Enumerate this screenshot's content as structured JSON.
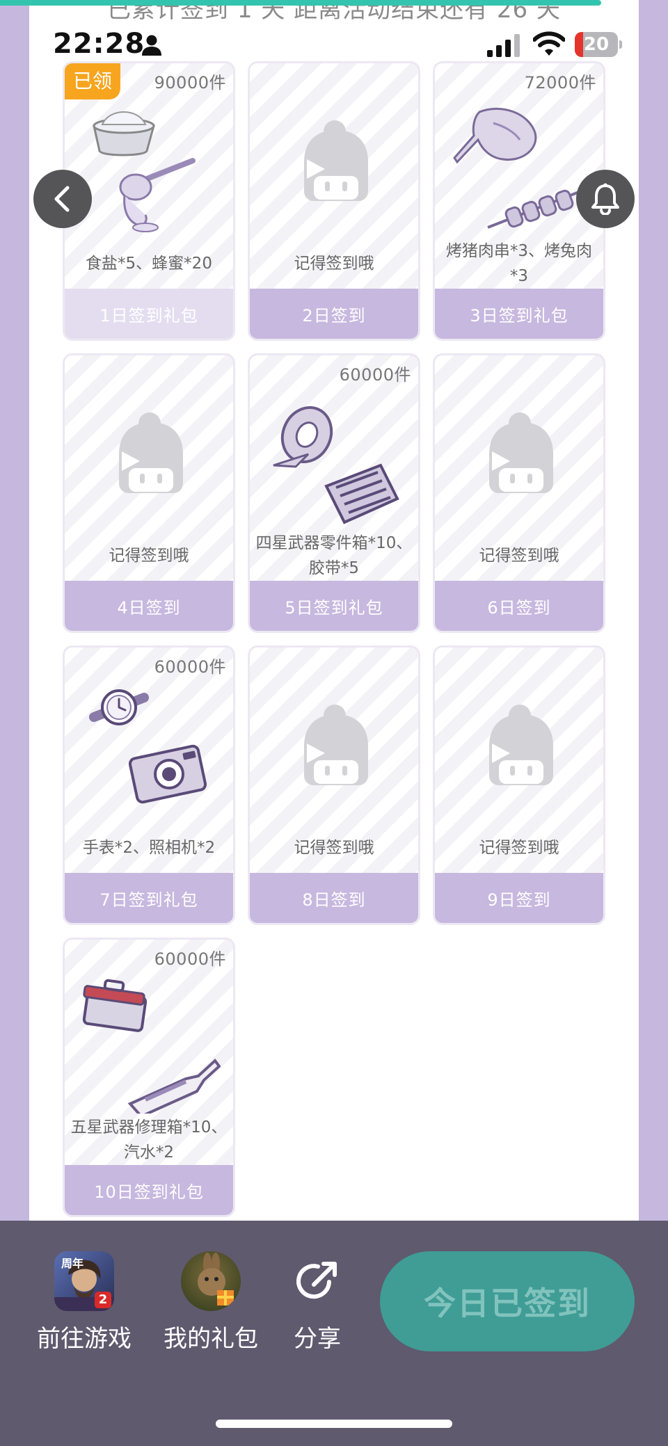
{
  "banner_text": "已累计签到 1 天  距离活动结束还有 26 天",
  "status_bar": {
    "time": "22:28",
    "battery": "20",
    "battery_level": 0.2
  },
  "cards": [
    {
      "count": "90000件",
      "desc": "食盐*5、蜂蜜*20",
      "footer": "1日签到礼包",
      "badge": "已领",
      "art": "salt-honey-icon"
    },
    {
      "count": "",
      "desc": "记得签到哦",
      "footer": "2日签到",
      "art": "mascot-placeholder-icon"
    },
    {
      "count": "72000件",
      "desc": "烤猪肉串*3、烤兔肉*3",
      "footer": "3日签到礼包",
      "art": "kebab-rabbit-icon"
    },
    {
      "count": "",
      "desc": "记得签到哦",
      "footer": "4日签到",
      "art": "mascot-placeholder-icon"
    },
    {
      "count": "60000件",
      "desc": "四星武器零件箱*10、胶带*5",
      "footer": "5日签到礼包",
      "art": "tape-toolbox-icon"
    },
    {
      "count": "",
      "desc": "记得签到哦",
      "footer": "6日签到",
      "art": "mascot-placeholder-icon"
    },
    {
      "count": "60000件",
      "desc": "手表*2、照相机*2",
      "footer": "7日签到礼包",
      "art": "watch-camera-icon"
    },
    {
      "count": "",
      "desc": "记得签到哦",
      "footer": "8日签到",
      "art": "mascot-placeholder-icon"
    },
    {
      "count": "",
      "desc": "记得签到哦",
      "footer": "9日签到",
      "art": "mascot-placeholder-icon"
    },
    {
      "count": "60000件",
      "desc": "五星武器修理箱*10、汽水*2",
      "footer": "10日签到礼包",
      "art": "repair-kit-soda-icon"
    }
  ],
  "bottom_bar": {
    "goto_game": {
      "label": "前往游戏",
      "badge_text": "周年",
      "corner": "2"
    },
    "my_gifts": {
      "label": "我的礼包"
    },
    "share": {
      "label": "分享"
    },
    "checkin_button": "今日已签到"
  },
  "colors": {
    "lavender": "#c6b7de",
    "card_footer": "#c7b8df",
    "claimed_badge": "#f7a51f",
    "checkin_button": "#3f9d96",
    "bottom_bar": "#5f5a6e"
  }
}
